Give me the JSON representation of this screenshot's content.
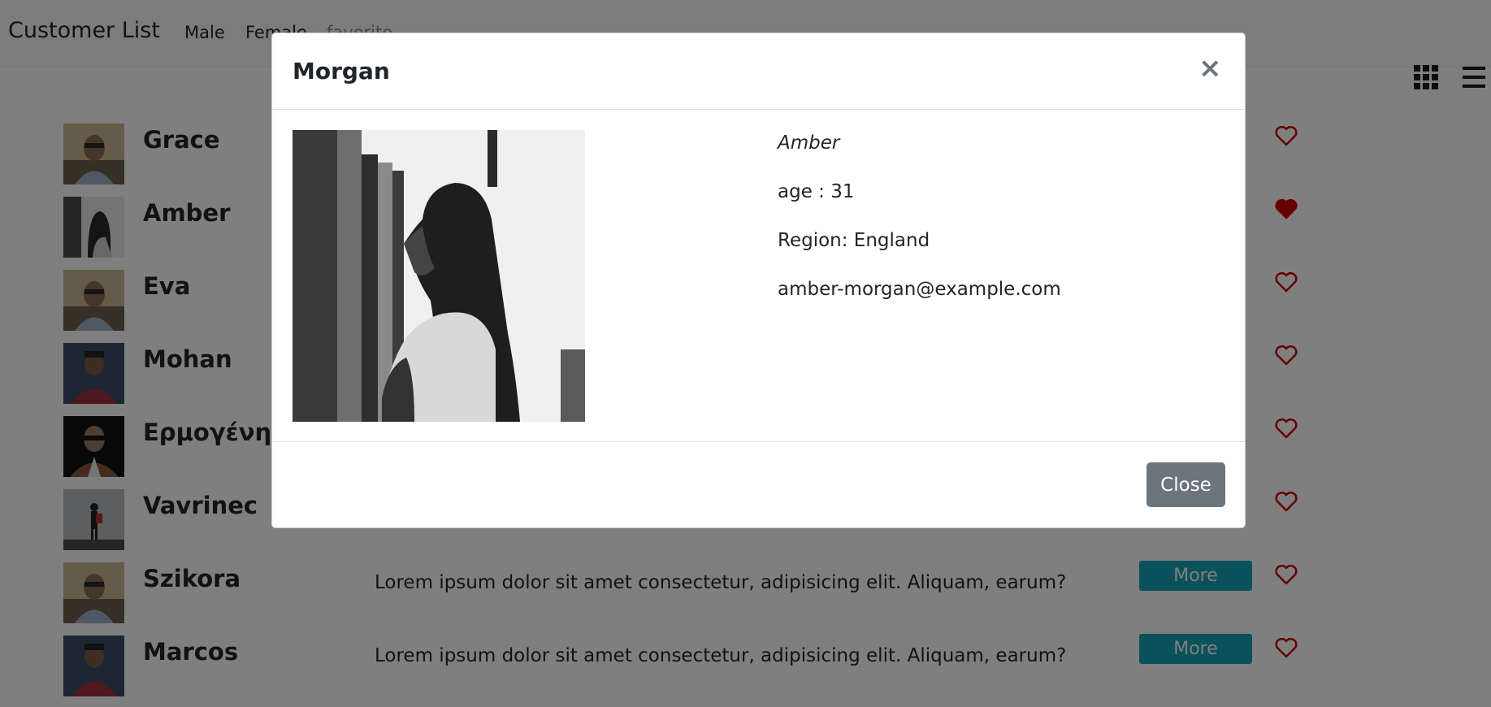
{
  "navbar": {
    "brand": "Customer List",
    "links": [
      "Male",
      "Female",
      "favorite"
    ]
  },
  "colors": {
    "accent": "#17a2b8",
    "heart": "#cc0000",
    "secondary": "#6c757d"
  },
  "customers": [
    {
      "name": "Grace",
      "favorite": false,
      "photo": "woman-sunglasses-photo"
    },
    {
      "name": "Amber",
      "favorite": true,
      "photo": "woman-profile-photo"
    },
    {
      "name": "Eva",
      "favorite": false,
      "photo": "woman-sunglasses-photo"
    },
    {
      "name": "Mohan",
      "favorite": false,
      "photo": "man-red-jacket-photo"
    },
    {
      "name": "Ερμογένης",
      "favorite": false,
      "photo": "man-sunglasses-photo"
    },
    {
      "name": "Vavrinec",
      "favorite": false,
      "photo": "hiker-photo"
    },
    {
      "name": "Szikora",
      "description": "Lorem ipsum dolor sit amet consectetur, adipisicing elit. Aliquam, earum?",
      "more_label": "More",
      "favorite": false,
      "photo": "woman-sunglasses-photo"
    },
    {
      "name": "Marcos",
      "description": "Lorem ipsum dolor sit amet consectetur, adipisicing elit. Aliquam, earum?",
      "more_label": "More",
      "favorite": false,
      "photo": "man-red-jacket-photo"
    }
  ],
  "modal": {
    "title": "Morgan",
    "close_symbol": "×",
    "first_name": "Amber",
    "age": "age : 31",
    "region": "Region: England",
    "email": "amber-morgan@example.com",
    "close_label": "Close",
    "photo": "woman-profile-photo"
  }
}
